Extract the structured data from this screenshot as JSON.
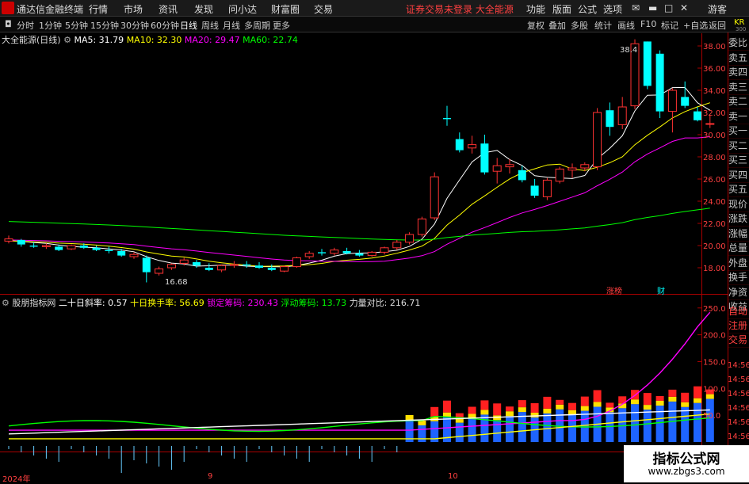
{
  "app": {
    "name": "通达信金融终端"
  },
  "menu": [
    "行情",
    "市场",
    "资讯",
    "发现",
    "问小达",
    "财富圈",
    "交易"
  ],
  "notice": "证券交易未登录  大全能源",
  "right_menu": [
    "功能",
    "版面",
    "公式",
    "选项"
  ],
  "guest": "游客",
  "periods": [
    "分时",
    "1分钟",
    "5分钟",
    "15分钟",
    "30分钟",
    "60分钟",
    "日线",
    "周线",
    "月线",
    "多周期",
    "更多"
  ],
  "active_period": "日线",
  "toolbar": [
    "复权",
    "叠加",
    "多股",
    "统计",
    "画线",
    "F10",
    "标记",
    "+自选",
    "返回"
  ],
  "price_info": {
    "title": "大全能源(日线)",
    "ma5": "MA5: 31.79",
    "ma10": "MA10: 32.30",
    "ma20": "MA20: 29.47",
    "ma60": "MA60: 22.74"
  },
  "indicator_info": {
    "name": "股朋指标网",
    "slope": "二十日斜率: 0.57",
    "turnover": "十日换手率: 56.69",
    "locked": "锁定筹码: 230.43",
    "floating": "浮动筹码: 13.73",
    "force": "力量对比: 216.71"
  },
  "right_panel": [
    "委比",
    "卖五",
    "卖四",
    "卖三",
    "卖二",
    "卖一",
    "买一",
    "买二",
    "买三",
    "买四",
    "买五",
    "现价",
    "涨跌",
    "涨幅",
    "总量",
    "外盘",
    "换手",
    "净资",
    "收益"
  ],
  "right_panel_lower": [
    "自动",
    "注册",
    "交易"
  ],
  "corner_code": "KR",
  "corner_sub": "300",
  "tags": {
    "zhangting": "涨榜",
    "cai": "财"
  },
  "annotations": {
    "high": "38.4",
    "low": "16.68"
  },
  "x_labels": [
    "2024年",
    "9",
    "10"
  ],
  "watermark": {
    "line1": "指标公式网",
    "line2": "www.zbgs3.com"
  },
  "colors": {
    "up": "#ff3232",
    "down": "#00ffff",
    "ma5": "#ffffff",
    "ma10": "#ffff00",
    "ma20": "#ff00ff",
    "ma60": "#00ff00"
  },
  "chart_data": {
    "type": "candlestick",
    "price_axis": {
      "ticks": [
        18.0,
        20.0,
        22.0,
        24.0,
        26.0,
        28.0,
        30.0,
        32.0,
        34.0,
        36.0,
        38.0
      ],
      "range": [
        16.5,
        39.0
      ]
    },
    "indicator_axis": {
      "ticks": [
        50.0,
        100.0,
        150.0,
        200.0,
        250.0
      ],
      "range": [
        0,
        260
      ],
      "tick_labels_extra": [
        "14:56",
        "14:56",
        "14:56",
        "14:56",
        "14:56",
        "14:56",
        "14:56"
      ]
    },
    "candles": [
      [
        20.4,
        20.9,
        20.2,
        20.6
      ],
      [
        20.5,
        20.6,
        19.9,
        20.1
      ],
      [
        20.0,
        20.3,
        19.8,
        19.9
      ],
      [
        19.9,
        20.2,
        19.7,
        20.0
      ],
      [
        19.9,
        20.1,
        19.5,
        19.6
      ],
      [
        19.7,
        20.1,
        19.6,
        20.0
      ],
      [
        20.0,
        20.2,
        19.7,
        19.8
      ],
      [
        19.8,
        20.0,
        19.5,
        19.6
      ],
      [
        19.6,
        19.9,
        19.3,
        19.5
      ],
      [
        19.5,
        19.7,
        19.0,
        19.1
      ],
      [
        19.0,
        19.4,
        18.8,
        19.2
      ],
      [
        18.9,
        19.1,
        16.68,
        17.6
      ],
      [
        17.5,
        18.1,
        17.3,
        17.9
      ],
      [
        18.0,
        18.4,
        17.8,
        18.3
      ],
      [
        18.4,
        18.9,
        18.2,
        18.7
      ],
      [
        18.5,
        18.7,
        18.0,
        18.2
      ],
      [
        18.0,
        18.4,
        17.7,
        17.8
      ],
      [
        17.8,
        18.3,
        17.6,
        18.2
      ],
      [
        18.2,
        18.6,
        18.0,
        18.3
      ],
      [
        18.3,
        18.6,
        18.0,
        18.2
      ],
      [
        18.2,
        18.5,
        17.9,
        18.0
      ],
      [
        18.0,
        18.3,
        17.7,
        17.8
      ],
      [
        17.7,
        18.2,
        17.6,
        18.1
      ],
      [
        18.1,
        19.0,
        18.0,
        18.9
      ],
      [
        19.0,
        19.5,
        18.8,
        19.3
      ],
      [
        19.4,
        19.7,
        19.1,
        19.3
      ],
      [
        19.3,
        19.8,
        19.1,
        19.6
      ],
      [
        19.5,
        19.8,
        19.2,
        19.3
      ],
      [
        19.3,
        19.6,
        19.0,
        19.1
      ],
      [
        19.1,
        19.5,
        19.0,
        19.4
      ],
      [
        19.4,
        19.9,
        19.2,
        19.8
      ],
      [
        19.8,
        20.5,
        19.6,
        20.3
      ],
      [
        20.3,
        21.2,
        20.1,
        21.0
      ],
      [
        21.0,
        22.6,
        20.8,
        22.4
      ],
      [
        22.5,
        26.6,
        22.3,
        26.2
      ],
      [
        31.5,
        32.6,
        30.8,
        31.4
      ],
      [
        29.6,
        30.2,
        28.4,
        28.6
      ],
      [
        28.8,
        29.9,
        28.3,
        29.1
      ],
      [
        29.2,
        30.0,
        26.4,
        26.6
      ],
      [
        26.7,
        27.9,
        25.6,
        27.2
      ],
      [
        27.1,
        27.8,
        26.5,
        27.3
      ],
      [
        26.8,
        27.2,
        25.7,
        25.9
      ],
      [
        25.4,
        26.0,
        24.3,
        24.5
      ],
      [
        24.4,
        26.1,
        24.1,
        25.9
      ],
      [
        25.8,
        27.1,
        25.6,
        26.9
      ],
      [
        26.8,
        27.4,
        26.1,
        27.0
      ],
      [
        27.0,
        27.5,
        26.7,
        27.3
      ],
      [
        27.1,
        32.4,
        26.8,
        32.0
      ],
      [
        32.2,
        32.9,
        29.9,
        30.7
      ],
      [
        30.9,
        33.4,
        30.5,
        32.5
      ],
      [
        32.6,
        38.6,
        32.3,
        38.2
      ],
      [
        38.4,
        38.4,
        34.1,
        34.4
      ],
      [
        37.3,
        37.6,
        31.5,
        32.1
      ],
      [
        32.1,
        34.2,
        30.2,
        34.0
      ],
      [
        33.4,
        34.8,
        32.4,
        32.6
      ],
      [
        32.1,
        32.5,
        31.2,
        31.3
      ],
      [
        31.0,
        31.8,
        30.6,
        31.0
      ]
    ]
  }
}
